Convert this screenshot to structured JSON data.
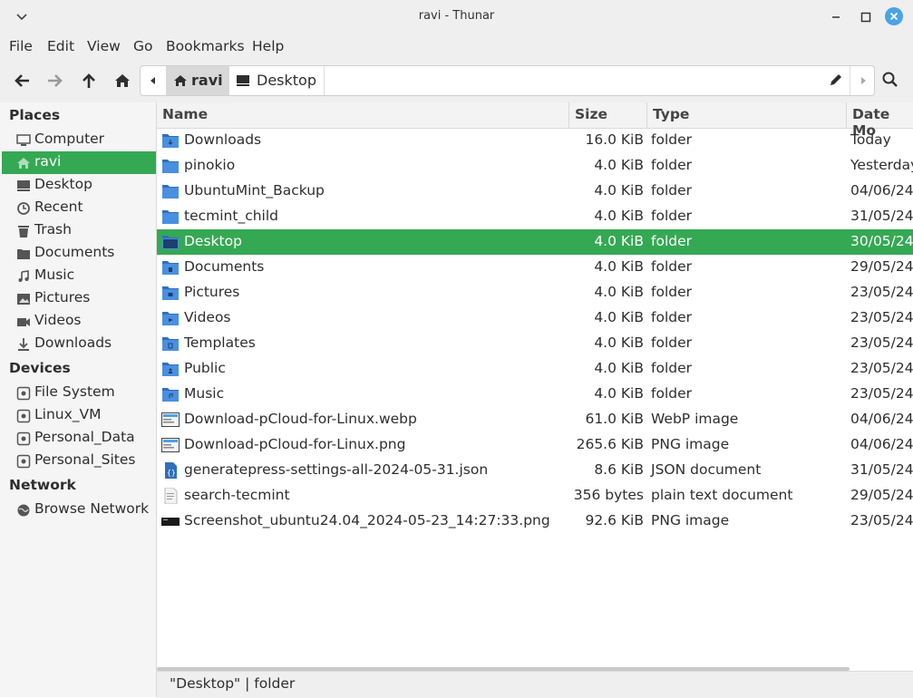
{
  "window": {
    "title": "ravi - Thunar"
  },
  "menu": [
    "File",
    "Edit",
    "View",
    "Go",
    "Bookmarks",
    "Help"
  ],
  "toolbar": {
    "back_icon": "arrow-left-icon",
    "forward_icon": "arrow-right-icon",
    "up_icon": "arrow-up-icon",
    "home_icon": "home-icon",
    "search_icon": "search-icon"
  },
  "path": {
    "home_label": "ravi",
    "desktop_label": "Desktop"
  },
  "sidebar": {
    "places_heading": "Places",
    "places": [
      {
        "label": "Computer",
        "icon": "computer-icon"
      },
      {
        "label": "ravi",
        "icon": "home-icon"
      },
      {
        "label": "Desktop",
        "icon": "desktop-icon"
      },
      {
        "label": "Recent",
        "icon": "clock-icon"
      },
      {
        "label": "Trash",
        "icon": "trash-icon"
      },
      {
        "label": "Documents",
        "icon": "folder-icon"
      },
      {
        "label": "Music",
        "icon": "music-icon"
      },
      {
        "label": "Pictures",
        "icon": "pictures-icon"
      },
      {
        "label": "Videos",
        "icon": "video-icon"
      },
      {
        "label": "Downloads",
        "icon": "download-icon"
      }
    ],
    "devices_heading": "Devices",
    "devices": [
      {
        "label": "File System",
        "icon": "drive-icon"
      },
      {
        "label": "Linux_VM",
        "icon": "drive-icon"
      },
      {
        "label": "Personal_Data",
        "icon": "drive-icon"
      },
      {
        "label": "Personal_Sites",
        "icon": "drive-icon"
      }
    ],
    "network_heading": "Network",
    "network": [
      {
        "label": "Browse Network",
        "icon": "network-icon"
      }
    ]
  },
  "columns": {
    "name": "Name",
    "size": "Size",
    "type": "Type",
    "date": "Date Mo"
  },
  "files": [
    {
      "name": "Downloads",
      "size": "16.0 KiB",
      "type": "folder",
      "date": "Today",
      "icon": "folder-download-icon"
    },
    {
      "name": "pinokio",
      "size": "4.0 KiB",
      "type": "folder",
      "date": "Yesterday",
      "icon": "folder-icon"
    },
    {
      "name": "UbuntuMint_Backup",
      "size": "4.0 KiB",
      "type": "folder",
      "date": "04/06/24",
      "icon": "folder-icon"
    },
    {
      "name": "tecmint_child",
      "size": "4.0 KiB",
      "type": "folder",
      "date": "31/05/24",
      "icon": "folder-icon"
    },
    {
      "name": "Desktop",
      "size": "4.0 KiB",
      "type": "folder",
      "date": "30/05/24",
      "icon": "folder-desktop-icon"
    },
    {
      "name": "Documents",
      "size": "4.0 KiB",
      "type": "folder",
      "date": "29/05/24",
      "icon": "folder-documents-icon"
    },
    {
      "name": "Pictures",
      "size": "4.0 KiB",
      "type": "folder",
      "date": "23/05/24",
      "icon": "folder-pictures-icon"
    },
    {
      "name": "Videos",
      "size": "4.0 KiB",
      "type": "folder",
      "date": "23/05/24",
      "icon": "folder-videos-icon"
    },
    {
      "name": "Templates",
      "size": "4.0 KiB",
      "type": "folder",
      "date": "23/05/24",
      "icon": "folder-templates-icon"
    },
    {
      "name": "Public",
      "size": "4.0 KiB",
      "type": "folder",
      "date": "23/05/24",
      "icon": "folder-public-icon"
    },
    {
      "name": "Music",
      "size": "4.0 KiB",
      "type": "folder",
      "date": "23/05/24",
      "icon": "folder-music-icon"
    },
    {
      "name": "Download-pCloud-for-Linux.webp",
      "size": "61.0 KiB",
      "type": "WebP image",
      "date": "04/06/24",
      "icon": "image-thumbnail-icon"
    },
    {
      "name": "Download-pCloud-for-Linux.png",
      "size": "265.6 KiB",
      "type": "PNG image",
      "date": "04/06/24",
      "icon": "image-thumbnail-icon"
    },
    {
      "name": "generatepress-settings-all-2024-05-31.json",
      "size": "8.6 KiB",
      "type": "JSON document",
      "date": "31/05/24",
      "icon": "json-file-icon"
    },
    {
      "name": "search-tecmint",
      "size": "356 bytes",
      "type": "plain text document",
      "date": "29/05/24",
      "icon": "text-file-icon"
    },
    {
      "name": "Screenshot_ubuntu24.04_2024-05-23_14:27:33.png",
      "size": "92.6 KiB",
      "type": "PNG image",
      "date": "23/05/24",
      "icon": "screenshot-thumbnail-icon"
    }
  ],
  "selected_file": "Desktop",
  "status": {
    "text": "\"Desktop\"  |  folder"
  },
  "colors": {
    "accent": "#35a854",
    "folder": "#4a8fe0",
    "close_button": "#4aa3e6"
  }
}
